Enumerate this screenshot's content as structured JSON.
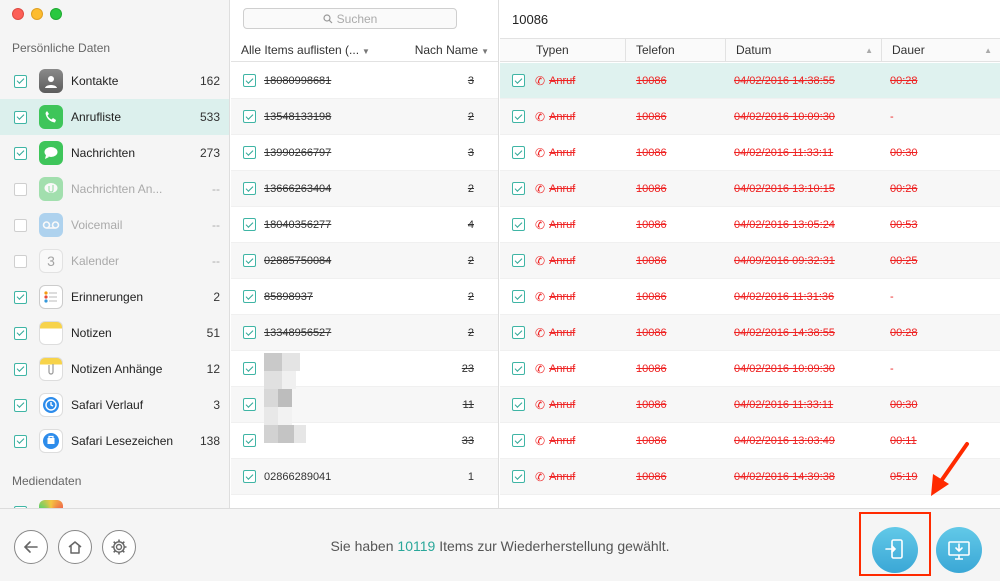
{
  "sidebar": {
    "section_personal": "Persönliche Daten",
    "section_media": "Mediendaten",
    "categories": [
      {
        "label": "Kontakte",
        "count": "162"
      },
      {
        "label": "Anrufliste",
        "count": "533"
      },
      {
        "label": "Nachrichten",
        "count": "273"
      },
      {
        "label": "Nachrichten An...",
        "count": "--"
      },
      {
        "label": "Voicemail",
        "count": "--"
      },
      {
        "label": "Kalender",
        "count": "--"
      },
      {
        "label": "Erinnerungen",
        "count": "2"
      },
      {
        "label": "Notizen",
        "count": "51"
      },
      {
        "label": "Notizen Anhänge",
        "count": "12"
      },
      {
        "label": "Safari Verlauf",
        "count": "3"
      },
      {
        "label": "Safari Lesezeichen",
        "count": "138"
      }
    ],
    "calendar_day": "3"
  },
  "middle": {
    "search_placeholder": "Suchen",
    "header_left": "Alle Items auflisten (...",
    "header_right": "Nach Name",
    "rows": [
      {
        "number": "18080998681",
        "count": "3"
      },
      {
        "number": "13548133198",
        "count": "2"
      },
      {
        "number": "13990266797",
        "count": "3"
      },
      {
        "number": "13666263404",
        "count": "2"
      },
      {
        "number": "18040356277",
        "count": "4"
      },
      {
        "number": "02885750084",
        "count": "2"
      },
      {
        "number": "85898937",
        "count": "2"
      },
      {
        "number": "13348956527",
        "count": "2"
      },
      {
        "number": "",
        "count": "23"
      },
      {
        "number": "",
        "count": "11"
      },
      {
        "number": "",
        "count": "33"
      },
      {
        "number": "02866289041",
        "count": "1"
      }
    ]
  },
  "detail": {
    "title": "10086",
    "columns": {
      "type": "Typen",
      "phone": "Telefon",
      "date": "Datum",
      "duration": "Dauer"
    },
    "rows": [
      {
        "type": "Anruf",
        "phone": "10086",
        "date": "04/02/2016 14:38:55",
        "duration": "00:28"
      },
      {
        "type": "Anruf",
        "phone": "10086",
        "date": "04/02/2016 10:09:30",
        "duration": "-"
      },
      {
        "type": "Anruf",
        "phone": "10086",
        "date": "04/02/2016 11:33:11",
        "duration": "00:30"
      },
      {
        "type": "Anruf",
        "phone": "10086",
        "date": "04/02/2016 13:10:15",
        "duration": "00:26"
      },
      {
        "type": "Anruf",
        "phone": "10086",
        "date": "04/02/2016 13:05:24",
        "duration": "00:53"
      },
      {
        "type": "Anruf",
        "phone": "10086",
        "date": "04/09/2016 09:32:31",
        "duration": "00:25"
      },
      {
        "type": "Anruf",
        "phone": "10086",
        "date": "04/02/2016 11:31:36",
        "duration": "-"
      },
      {
        "type": "Anruf",
        "phone": "10086",
        "date": "04/02/2016 14:38:55",
        "duration": "00:28"
      },
      {
        "type": "Anruf",
        "phone": "10086",
        "date": "04/02/2016 10:09:30",
        "duration": "-"
      },
      {
        "type": "Anruf",
        "phone": "10086",
        "date": "04/02/2016 11:33:11",
        "duration": "00:30"
      },
      {
        "type": "Anruf",
        "phone": "10086",
        "date": "04/02/2016 13:03:49",
        "duration": "00:11"
      },
      {
        "type": "Anruf",
        "phone": "10086",
        "date": "04/02/2016 14:39:38",
        "duration": "05:19"
      }
    ]
  },
  "bottom": {
    "status_prefix": "Sie haben",
    "status_count": "10119",
    "status_suffix": "Items zur Wiederherstellung gewählt."
  },
  "colors": {
    "accent": "#2aa79a",
    "deleted": "#ee2222",
    "highlight": "#ff2a00"
  }
}
